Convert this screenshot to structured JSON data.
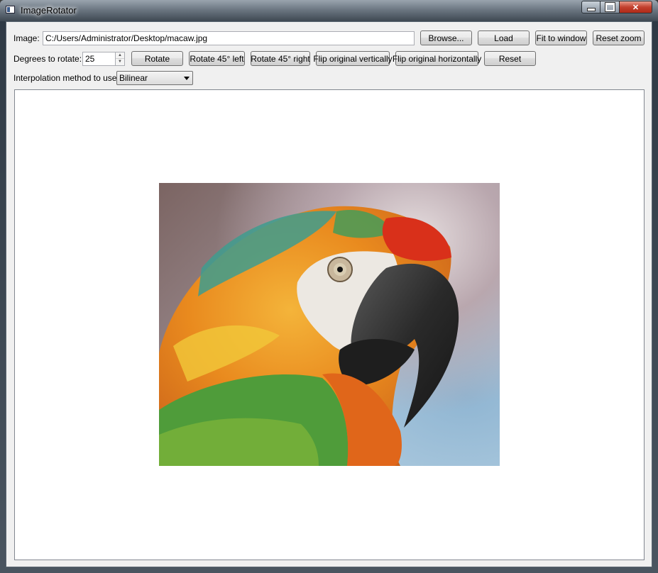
{
  "window": {
    "title": "ImageRotator"
  },
  "image_row": {
    "label": "Image:",
    "path": "C:/Users/Administrator/Desktop/macaw.jpg",
    "browse": "Browse...",
    "load": "Load",
    "fit": "Fit to window",
    "reset_zoom": "Reset zoom"
  },
  "rotate_row": {
    "label": "Degrees to rotate:",
    "degrees": "25",
    "rotate": "Rotate",
    "rot_left": "Rotate 45° left",
    "rot_right": "Rotate 45° right",
    "flip_v": "Flip original vertically",
    "flip_h": "Flip original horizontally",
    "reset": "Reset"
  },
  "interp_row": {
    "label": "Interpolation method to use:",
    "selected": "Bilinear"
  },
  "colors": {
    "close_red": "#c2402e",
    "canvas_bg": "#ffffff"
  }
}
